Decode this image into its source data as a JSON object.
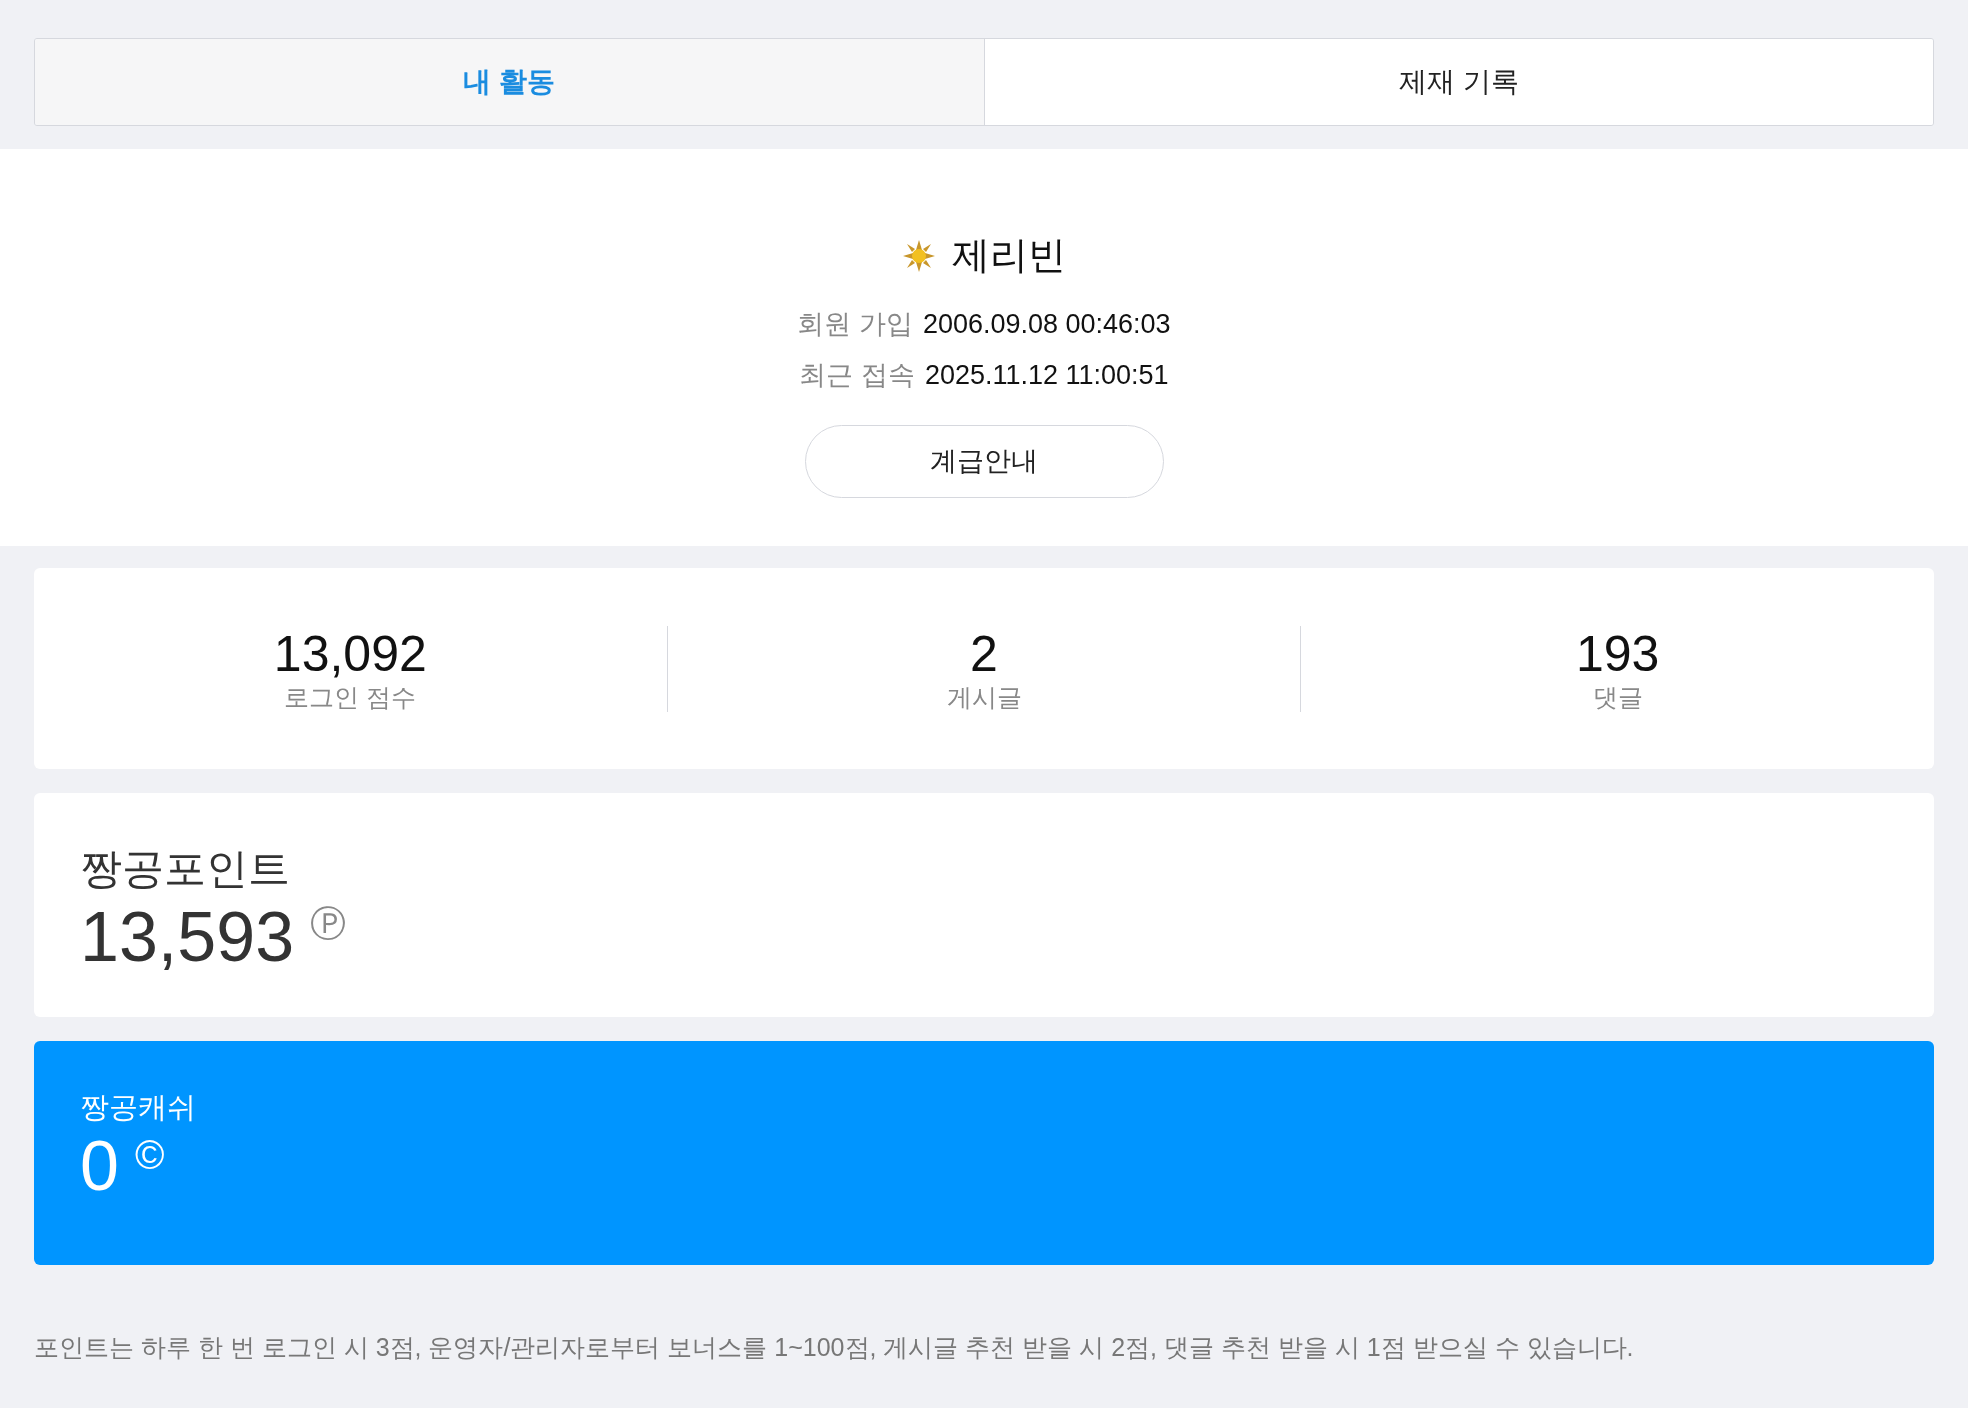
{
  "tabs": [
    {
      "label": "내 활동",
      "selected": true
    },
    {
      "label": "제재 기록",
      "selected": false
    }
  ],
  "profile": {
    "name": "제리빈",
    "info": [
      {
        "label": "회원 가입",
        "value": "2006.09.08 00:46:03"
      },
      {
        "label": "최근 접속",
        "value": "2025.11.12 11:00:51"
      }
    ],
    "button": "계급안내"
  },
  "stats": [
    {
      "value": "13,092",
      "label": "로그인 점수"
    },
    {
      "value": "2",
      "label": "게시글"
    },
    {
      "value": "193",
      "label": "댓글"
    }
  ],
  "balances": [
    {
      "kind": "points",
      "title": "짱공포인트",
      "value": "13,593",
      "unit": "Ⓟ"
    },
    {
      "kind": "cash",
      "title": "짱공캐쉬",
      "value": "0",
      "unit": "©"
    }
  ],
  "note": "포인트는 하루 한 번 로그인 시 3점, 운영자/관리자로부터 보너스를 1~100점, 게시글 추천 받을 시 2점, 댓글 추천 받을 시 1점 받으실 수 있습니다."
}
